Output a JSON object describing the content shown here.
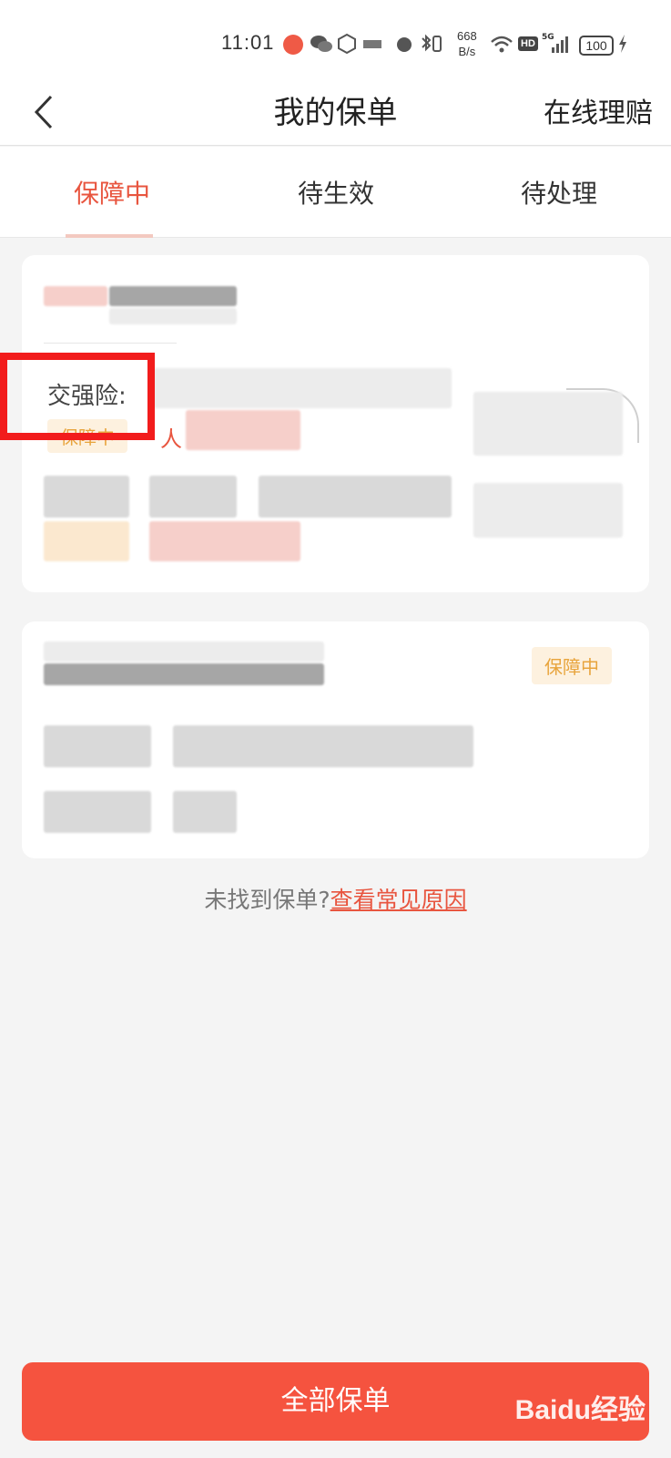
{
  "status_bar": {
    "time": "11:01",
    "net_speed": "668",
    "net_unit": "B/s",
    "hd": "HD",
    "network": "5G",
    "battery": "100"
  },
  "header": {
    "title": "我的保单",
    "claim_link": "在线理赔"
  },
  "tabs": [
    {
      "label": "保障中",
      "active": true
    },
    {
      "label": "待生效",
      "active": false
    },
    {
      "label": "待处理",
      "active": false
    }
  ],
  "policies": [
    {
      "insurance_label": "交强险:",
      "status": "保障中",
      "person": "人"
    },
    {
      "status": "保障中"
    }
  ],
  "footer": {
    "not_found_text": "未找到保单?",
    "reason_link": "查看常见原因",
    "all_policies_button": "全部保单"
  },
  "watermark": "Baidu经验",
  "colors": {
    "accent": "#e8553f",
    "button": "#f5533f",
    "tag_text": "#e8a43c",
    "annotation": "#f21c1c"
  }
}
